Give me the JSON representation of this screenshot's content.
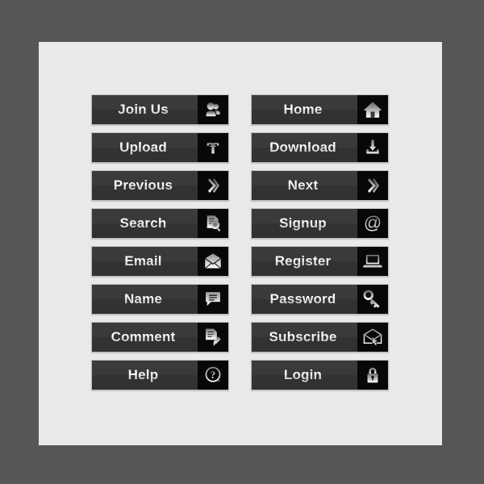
{
  "page": {
    "background_color": "#565658",
    "panel_color": "#e9e9eb",
    "button_color": "#383838",
    "icon_block_color": "#080808",
    "label_color": "#f2f2f2"
  },
  "columns": [
    {
      "name": "left-column",
      "buttons": [
        {
          "label": "Join Us",
          "icon": "users-icon"
        },
        {
          "label": "Upload",
          "icon": "upload-tray-icon"
        },
        {
          "label": "Previous",
          "icon": "chevron-left-arrow-icon"
        },
        {
          "label": "Search",
          "icon": "document-magnifier-icon"
        },
        {
          "label": "Email",
          "icon": "envelope-icon"
        },
        {
          "label": "Name",
          "icon": "speech-bubble-icon"
        },
        {
          "label": "Comment",
          "icon": "document-pen-icon"
        },
        {
          "label": "Help",
          "icon": "question-mark-circle-icon"
        }
      ]
    },
    {
      "name": "right-column",
      "buttons": [
        {
          "label": "Home",
          "icon": "house-icon"
        },
        {
          "label": "Download",
          "icon": "download-tray-icon"
        },
        {
          "label": "Next",
          "icon": "chevron-right-arrow-icon"
        },
        {
          "label": "Signup",
          "icon": "at-sign-icon"
        },
        {
          "label": "Register",
          "icon": "laptop-icon"
        },
        {
          "label": "Password",
          "icon": "key-icon"
        },
        {
          "label": "Subscribe",
          "icon": "envelope-cursor-icon"
        },
        {
          "label": "Login",
          "icon": "padlock-icon"
        }
      ]
    }
  ]
}
